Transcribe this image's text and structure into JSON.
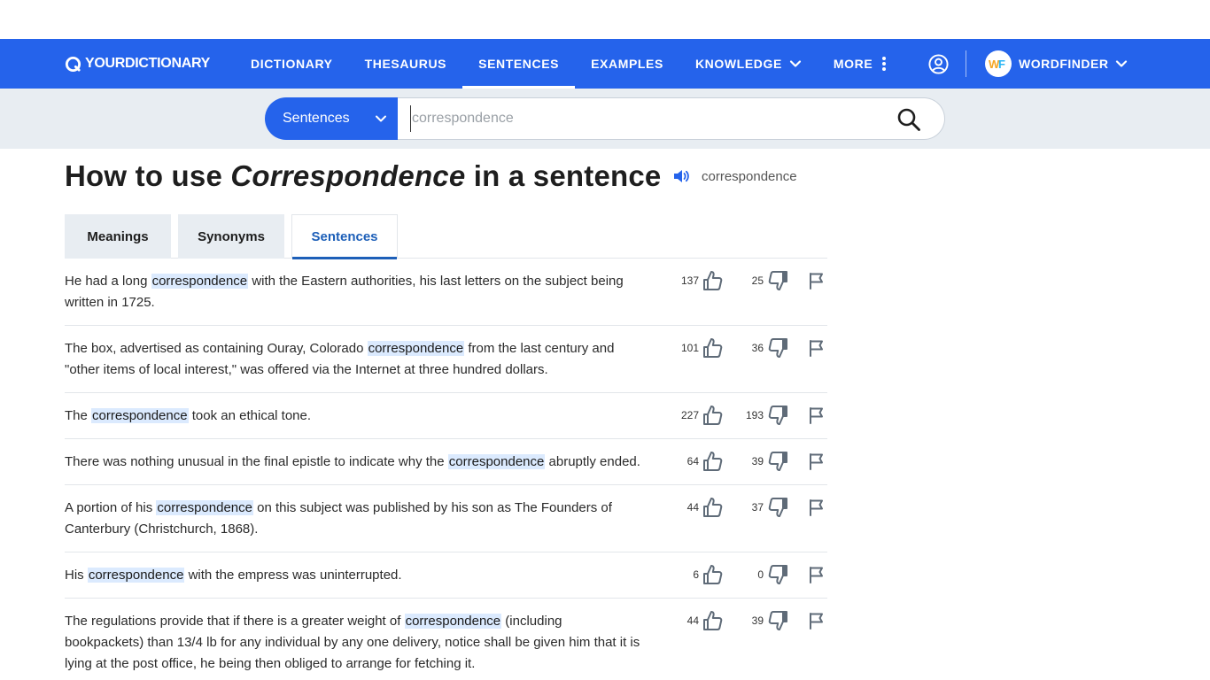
{
  "header": {
    "logo_text": "YOURDICTIONARY",
    "nav": [
      {
        "label": "DICTIONARY"
      },
      {
        "label": "THESAURUS"
      },
      {
        "label": "SENTENCES",
        "active": true
      },
      {
        "label": "EXAMPLES"
      },
      {
        "label": "KNOWLEDGE",
        "icon": "chevron-down-icon"
      },
      {
        "label": "MORE",
        "icon": "vertical-dots-icon"
      }
    ],
    "account_icon": "user-circle-icon",
    "wordfinder": {
      "badge": "WF",
      "label": "WORDFINDER",
      "icon": "chevron-down-icon"
    },
    "colors": {
      "brand": "#2563eb"
    }
  },
  "search": {
    "select_label": "Sentences",
    "placeholder": "correspondence",
    "value": "",
    "icon": "search-icon"
  },
  "page": {
    "title_prefix": "How to use ",
    "title_word": "Correspondence",
    "title_suffix": " in a sentence",
    "audio_icon": "speaker-icon",
    "pronunciation": "correspondence"
  },
  "tabs": [
    {
      "label": "Meanings"
    },
    {
      "label": "Synonyms"
    },
    {
      "label": "Sentences",
      "active": true
    }
  ],
  "sentences": [
    {
      "before": "He had a long ",
      "word": "correspondence",
      "after": " with the Eastern authorities, his last letters on the subject being written in 1725.",
      "up": "137",
      "down": "25"
    },
    {
      "before": "The box, advertised as containing Ouray, Colorado ",
      "word": "correspondence",
      "after": " from the last century and \"other items of local interest,\" was offered via the Internet at three hundred dollars.",
      "up": "101",
      "down": "36"
    },
    {
      "before": "The ",
      "word": "correspondence",
      "after": " took an ethical tone.",
      "up": "227",
      "down": "193"
    },
    {
      "before": "There was nothing unusual in the final epistle to indicate why the ",
      "word": "correspondence",
      "after": " abruptly ended.",
      "up": "64",
      "down": "39"
    },
    {
      "before": "A portion of his ",
      "word": "correspondence",
      "after": " on this subject was published by his son as The Founders of Canterbury (Christchurch, 1868).",
      "up": "44",
      "down": "37"
    },
    {
      "before": "His ",
      "word": "correspondence",
      "after": " with the empress was uninterrupted.",
      "up": "6",
      "down": "0"
    },
    {
      "before": "The regulations provide that if there is a greater weight of ",
      "word": "correspondence",
      "after": " (including bookpackets) than 13/4 lb for any individual by any one delivery, notice shall be given him that it is lying at the post office, he being then obliged to arrange for fetching it.",
      "up": "44",
      "down": "39"
    }
  ],
  "row_icons": {
    "upvote": "thumbs-up-icon",
    "downvote": "thumbs-down-icon",
    "report": "flag-icon"
  }
}
